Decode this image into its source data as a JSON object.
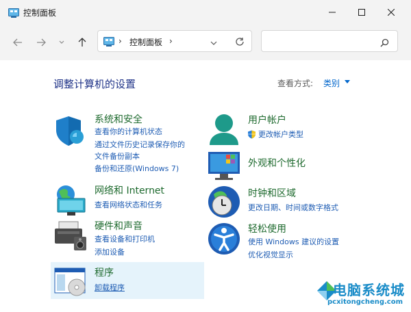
{
  "window": {
    "title": "控制面板"
  },
  "address": {
    "path": "控制面板",
    "search_placeholder": ""
  },
  "content": {
    "heading": "调整计算机的设置",
    "view_by_label": "查看方式:",
    "view_by_value": "类别"
  },
  "categories": {
    "security": {
      "title": "系统和安全",
      "links": [
        "查看你的计算机状态",
        "通过文件历史记录保存你的",
        "文件备份副本",
        "备份和还原(Windows 7)"
      ]
    },
    "network": {
      "title": "网络和 Internet",
      "links": [
        "查看网络状态和任务"
      ]
    },
    "hardware": {
      "title": "硬件和声音",
      "links": [
        "查看设备和打印机",
        "添加设备"
      ]
    },
    "programs": {
      "title": "程序",
      "links": [
        "卸载程序"
      ]
    },
    "user": {
      "title": "用户帐户",
      "links": [
        "更改帐户类型"
      ]
    },
    "appearance": {
      "title": "外观和个性化",
      "links": []
    },
    "clock": {
      "title": "时钟和区域",
      "links": [
        "更改日期、时间或数字格式"
      ]
    },
    "access": {
      "title": "轻松使用",
      "links": [
        "使用 Windows 建议的设置",
        "优化视觉显示"
      ]
    }
  },
  "watermark": {
    "text": "电脑系统城",
    "url": "pcxitongcheng.com"
  }
}
